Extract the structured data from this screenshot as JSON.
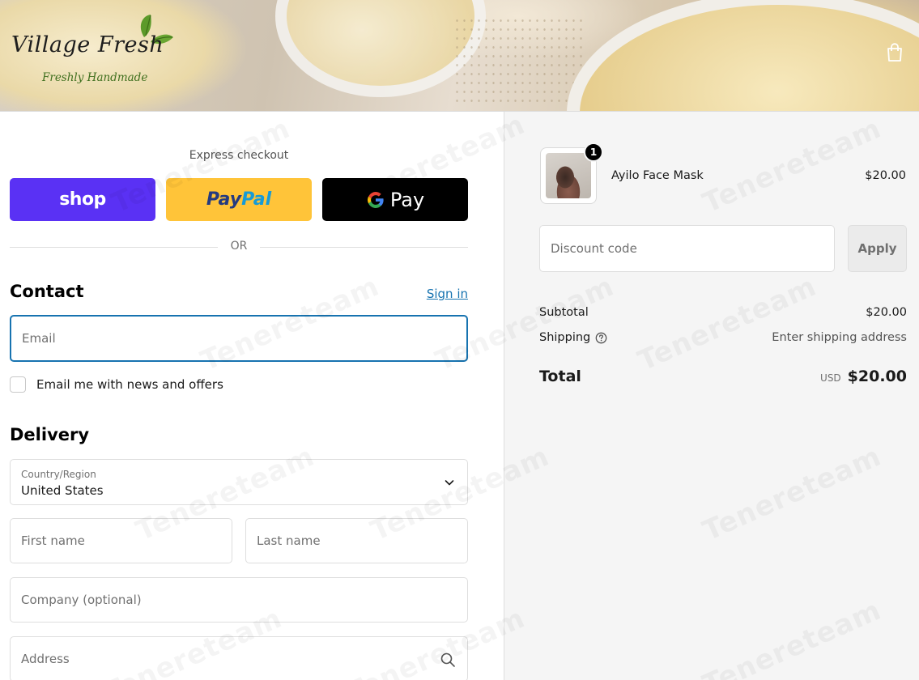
{
  "brand": {
    "name": "Village Fresh",
    "tagline": "Freshly Handmade"
  },
  "icons": {
    "cart": "shopping-bag-icon",
    "leaf": "leaf-icon",
    "chevron": "chevron-down-icon",
    "search": "search-icon",
    "help": "question-circle-icon"
  },
  "express": {
    "label": "Express checkout",
    "shop_label": "shop",
    "paypal_part1": "Pay",
    "paypal_part2": "Pal",
    "gpay_g": "G",
    "gpay_label": "Pay",
    "or_text": "OR"
  },
  "contact": {
    "title": "Contact",
    "sign_in": "Sign in",
    "email_placeholder": "Email",
    "email_value": "",
    "newsletter_label": "Email me with news and offers",
    "newsletter_checked": false
  },
  "delivery": {
    "title": "Delivery",
    "country_label": "Country/Region",
    "country_value": "United States",
    "first_name_placeholder": "First name",
    "last_name_placeholder": "Last name",
    "company_placeholder": "Company (optional)",
    "address_placeholder": "Address"
  },
  "summary": {
    "item": {
      "name": "Ayilo Face Mask",
      "price": "$20.00",
      "quantity": "1"
    },
    "discount_placeholder": "Discount code",
    "apply_label": "Apply",
    "subtotal_label": "Subtotal",
    "subtotal_value": "$20.00",
    "shipping_label": "Shipping",
    "shipping_value": "Enter shipping address",
    "total_label": "Total",
    "currency": "USD",
    "total_value": "$20.00"
  },
  "watermark_text": "Tenereteam",
  "colors": {
    "shop_purple": "#5a31f4",
    "paypal_yellow": "#ffc439",
    "paypal_dark": "#253b80",
    "paypal_light": "#179bd7",
    "link_blue": "#1773b0",
    "summary_bg": "#f5f5f5"
  }
}
